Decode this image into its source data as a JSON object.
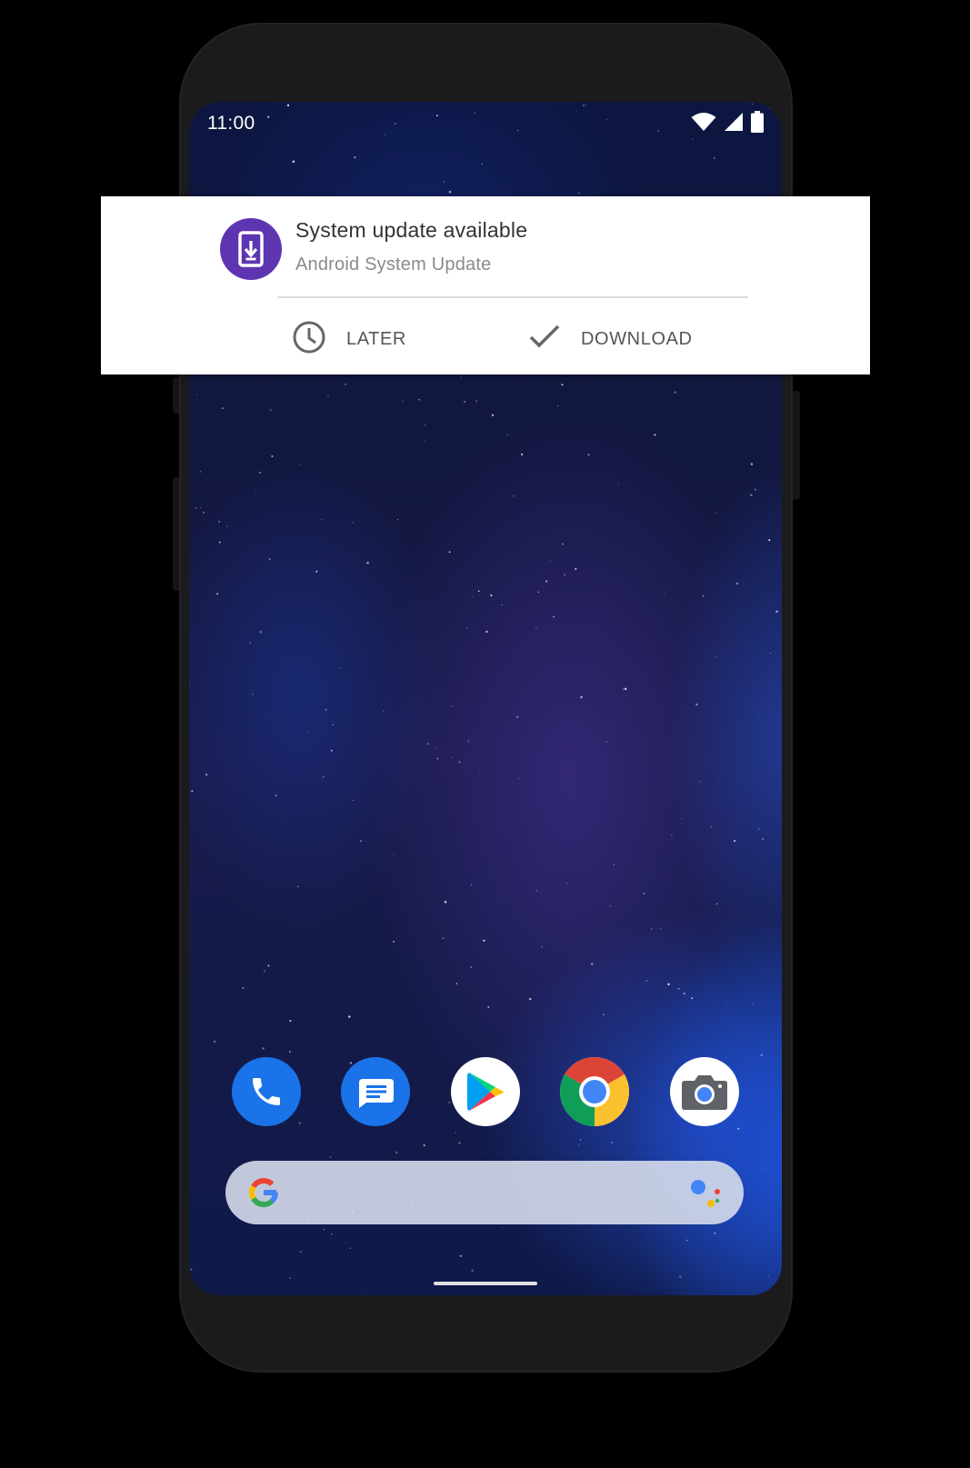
{
  "status_bar": {
    "time": "11:00",
    "icons": [
      "wifi-icon",
      "cell-signal-icon",
      "battery-icon"
    ]
  },
  "notification": {
    "title": "System update available",
    "subtitle": "Android System Update",
    "app_icon": "system-update-icon",
    "icon_color": "#5e35b1",
    "actions": [
      {
        "label": "LATER",
        "icon": "clock-icon"
      },
      {
        "label": "DOWNLOAD",
        "icon": "check-icon"
      }
    ]
  },
  "dock": {
    "apps": [
      {
        "name": "Phone",
        "icon": "phone-icon",
        "color": "#1a73e8"
      },
      {
        "name": "Messages",
        "icon": "messages-icon",
        "color": "#1a73e8"
      },
      {
        "name": "Play Store",
        "icon": "play-store-icon",
        "color": "#ffffff"
      },
      {
        "name": "Chrome",
        "icon": "chrome-icon",
        "color": "#db4437"
      },
      {
        "name": "Camera",
        "icon": "camera-icon",
        "color": "#ffffff"
      }
    ]
  },
  "search_bar": {
    "logo": "google-g-icon",
    "assistant": "google-assistant-icon"
  },
  "colors": {
    "notification_bg": "#ffffff",
    "wallpaper_dark": "#12173f",
    "wallpaper_blue": "#1d4fd0",
    "phone_body": "#1b1b1d"
  }
}
